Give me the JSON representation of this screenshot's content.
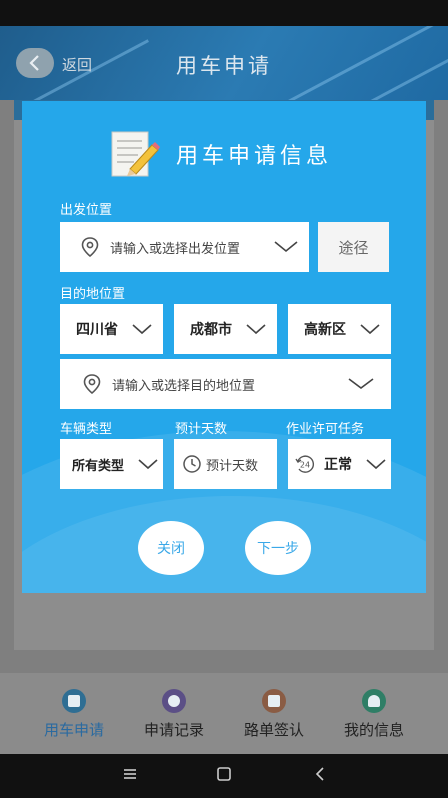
{
  "header": {
    "back_label": "返回",
    "title": "用车申请"
  },
  "modal": {
    "title": "用车申请信息",
    "departure": {
      "label": "出发位置",
      "placeholder": "请输入或选择出发位置",
      "route_button": "途径"
    },
    "destination": {
      "label": "目的地位置",
      "province": "四川省",
      "city": "成都市",
      "district": "高新区",
      "placeholder": "请输入或选择目的地位置"
    },
    "vehicle_type": {
      "label": "车辆类型",
      "value": "所有类型"
    },
    "estimated_days": {
      "label": "预计天数",
      "placeholder": "预计天数"
    },
    "work_permit": {
      "label": "作业许可任务",
      "value": "正常"
    },
    "close_button": "关闭",
    "next_button": "下一步"
  },
  "tabbar": {
    "tabs": [
      {
        "label": "用车申请",
        "icon": "home-icon",
        "color": "#2f6e93"
      },
      {
        "label": "申请记录",
        "icon": "location-icon",
        "color": "#5b4f86"
      },
      {
        "label": "路单签认",
        "icon": "document-icon",
        "color": "#8a5c44"
      },
      {
        "label": "我的信息",
        "icon": "user-icon",
        "color": "#2f7e66"
      }
    ],
    "active_index": 0
  },
  "colors": {
    "modal_bg": "#25a7ea",
    "accent": "#3aa8e8"
  }
}
